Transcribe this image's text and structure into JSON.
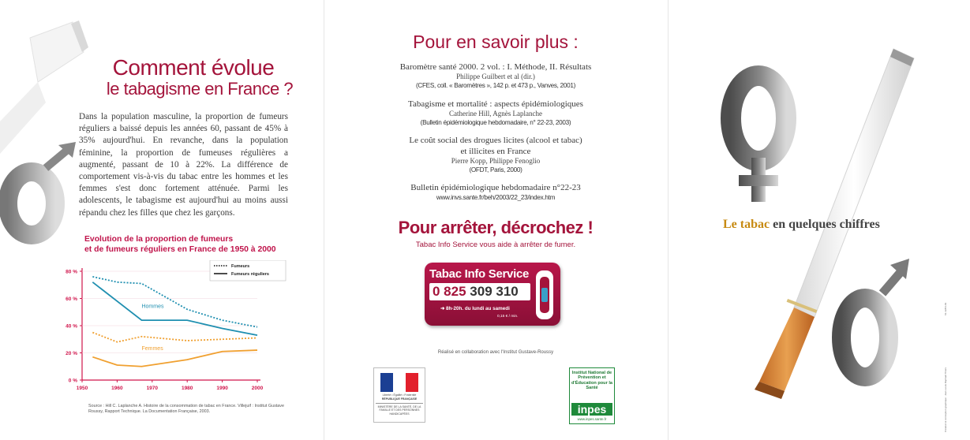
{
  "left": {
    "title_line1": "Comment évolue",
    "title_line2": "le tabagisme en France ?",
    "intro": "Dans la population masculine, la proportion de fumeurs réguliers a baissé depuis les années 60, passant de 45% à 35% aujourd'hui. En revanche, dans la population féminine, la proportion de fumeuses régulières a augmenté, passant de 10 à 22%. La différence de comportement vis-à-vis du tabac entre les hommes et les femmes s'est donc fortement atténuée. Parmi les adolescents, le tabagisme est aujourd'hui au moins aussi répandu chez les filles que chez les garçons.",
    "chart_title_line1": "Evolution de la proportion de fumeurs",
    "chart_title_line2": "et de fumeurs réguliers en France de 1950 à 2000",
    "source": "Source : Hill C. Laplanche A. Histoire de la consommation de tabac en France. Villejuif : Institut Gustave Roussy, Rapport Technique. La Documentation Française, 2003."
  },
  "chart_data": {
    "type": "line",
    "title": "Evolution de la proportion de fumeurs et de fumeurs réguliers en France de 1950 à 2000",
    "xlabel": "",
    "ylabel": "",
    "x_ticks": [
      "1950",
      "1960",
      "1970",
      "1980",
      "1990",
      "2000"
    ],
    "y_ticks": [
      "0 %",
      "20 %",
      "40 %",
      "60 %",
      "80 %"
    ],
    "xlim": [
      1950,
      2000
    ],
    "ylim": [
      0,
      80
    ],
    "legend": [
      "Fumeurs",
      "Fumeurs réguliers"
    ],
    "legend_position": "top-right",
    "group_labels": {
      "men": "Hommes",
      "women": "Femmes"
    },
    "colors": {
      "men": "#1f8fb0",
      "women": "#f0a030",
      "axis": "#d0144b"
    },
    "series": [
      {
        "name": "Fumeurs",
        "group": "men",
        "style": "dotted",
        "x": [
          1953,
          1960,
          1967,
          1980,
          1990,
          2000
        ],
        "y": [
          76,
          72,
          71,
          52,
          44,
          39
        ]
      },
      {
        "name": "Fumeurs réguliers",
        "group": "men",
        "style": "solid",
        "x": [
          1953,
          1967,
          1980,
          1990,
          2000
        ],
        "y": [
          72,
          44,
          44,
          38,
          33
        ]
      },
      {
        "name": "Fumeurs",
        "group": "women",
        "style": "dotted",
        "x": [
          1953,
          1960,
          1967,
          1980,
          1990,
          2000
        ],
        "y": [
          35,
          28,
          32,
          29,
          30,
          31
        ]
      },
      {
        "name": "Fumeurs réguliers",
        "group": "women",
        "style": "solid",
        "x": [
          1953,
          1960,
          1967,
          1980,
          1990,
          2000
        ],
        "y": [
          17,
          11,
          10,
          15,
          21,
          22
        ]
      }
    ]
  },
  "middle": {
    "title": "Pour en savoir plus :",
    "references": [
      {
        "title": "Baromètre santé 2000. 2 vol. : I. Méthode, II. Résultats",
        "author": "Philippe Guilbert et al (dir.)",
        "pub": "(CFES, coll. « Baromètres », 142 p. et 473 p., Vanves, 2001)"
      },
      {
        "title": "Tabagisme et mortalité : aspects épidémiologiques",
        "author": "Catherine Hill, Agnès Laplanche",
        "pub": "(Bulletin épidémiologique hebdomadaire, n° 22-23, 2003)"
      },
      {
        "title": "Le coût social des drogues licites (alcool et tabac)",
        "title2": "et illicites en France",
        "author": "Pierre Kopp, Philippe Fenoglio",
        "pub": "(OFDT, Paris, 2000)"
      },
      {
        "title": "Bulletin épidémiologique hebdomadaire n°22-23",
        "pub": "www.invs.sante.fr/beh/2003/22_23/index.htm"
      }
    ],
    "quit_title": "Pour arrêter, décrochez !",
    "quit_sub": "Tabac Info Service vous aide à arrêter de fumer.",
    "tis": {
      "title": "Tabac Info Service",
      "num_a": "0 825",
      "num_b": "309 310",
      "hours": "8h-20h. du lundi au samedi",
      "price": "0,15 € / min."
    },
    "collab": "Réalisé en collaboration avec l'Institut Gustave-Roussy",
    "rf": {
      "motto": "Liberté • Égalité • Fraternité",
      "name": "RÉPUBLIQUE FRANÇAISE",
      "ministry": "MINISTÈRE DE LA SANTÉ, DE LA FAMILLE ET DES PERSONNES HANDICAPÉES",
      "flag_colors": [
        "#1b3f93",
        "#ffffff",
        "#e2202c"
      ]
    },
    "inpes": {
      "text": "Institut National de Prévention et d'Éducation pour la Santé",
      "brand": "inpes",
      "url": "www.inpes.sante.fr"
    }
  },
  "right": {
    "tagline_accent": "Le tabac",
    "tagline_rest": " en quelques chiffres",
    "print_ref": "61-12/04-03",
    "credit": "Création & conception graphique : Jean-Louis Raphaël Thiers"
  },
  "colors": {
    "brand_red": "#a4143b",
    "cig_orange": "#d98a3a",
    "gray_symbol": "#6b6b6b"
  }
}
